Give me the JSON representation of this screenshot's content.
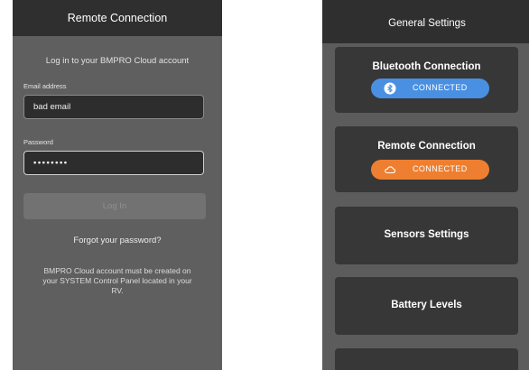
{
  "remote_screen": {
    "title": "Remote Connection",
    "intro": "Log in to your BMPRO Cloud account",
    "email": {
      "label": "Email address",
      "value": "bad email"
    },
    "password": {
      "label": "Password",
      "value": "••••••••"
    },
    "login_label": "Log In",
    "forgot_label": "Forgot your password?",
    "note": "BMPRO Cloud account must be created on your SYSTEM Control Panel located in your RV."
  },
  "settings_screen": {
    "title": "General Settings",
    "cards": [
      {
        "title": "Bluetooth Connection",
        "status": "CONNECTED",
        "status_color": "#4a90e2",
        "icon": "bluetooth-icon"
      },
      {
        "title": "Remote Connection",
        "status": "CONNECTED",
        "status_color": "#ee7f30",
        "icon": "cloud-icon"
      },
      {
        "title": "Sensors Settings"
      },
      {
        "title": "Battery Levels"
      }
    ]
  },
  "colors": {
    "accent_blue": "#4a90e2",
    "accent_orange": "#ee7f30",
    "topbar": "#2f2f2f",
    "card": "#373737"
  }
}
